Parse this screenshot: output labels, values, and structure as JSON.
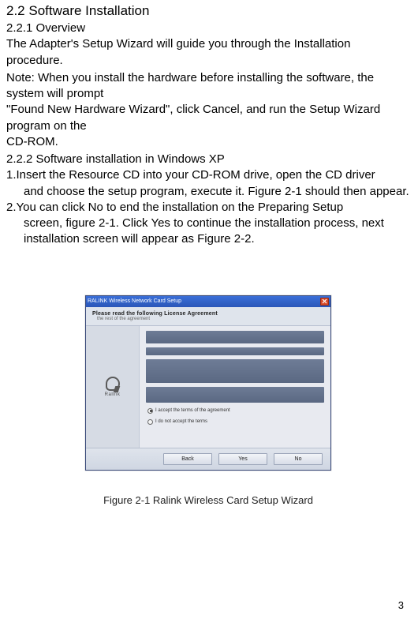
{
  "section": {
    "h22": "2.2 Software Installation",
    "h221": "2.2.1 Overview",
    "p1": "The Adapter's Setup Wizard will guide you through the Installation procedure.",
    "p2": "Note: When you install the hardware before installing the software, the system will prompt",
    "p3": "\"Found New Hardware Wizard\", click Cancel, and run the Setup Wizard program on the",
    "p4": "CD-ROM.",
    "h222": "2.2.2 Software installation in Windows XP",
    "li1a": "1.Insert the Resource CD into your CD-ROM drive, open the CD driver",
    "li1b": "and choose the setup program, execute it. Figure 2-1 should then appear.",
    "li2a": "2.You can click No to end the installation on the Preparing Setup",
    "li2b": "screen, figure 2-1.  Click Yes to continue the installation process, next installation screen will appear as Figure 2-2."
  },
  "wizard": {
    "title": "RALINK Wireless Network Card Setup",
    "subheader1": "Please read the following License Agreement",
    "subheader2": "the rest of the agreement",
    "logo_text": "Ralink",
    "radio_accept": "I accept the terms of the agreement",
    "radio_reject": "I do not accept the terms",
    "btn_back": "Back",
    "btn_yes": "Yes",
    "btn_no": "No"
  },
  "caption": "Figure 2-1 Ralink Wireless Card Setup Wizard",
  "page_num": "3"
}
